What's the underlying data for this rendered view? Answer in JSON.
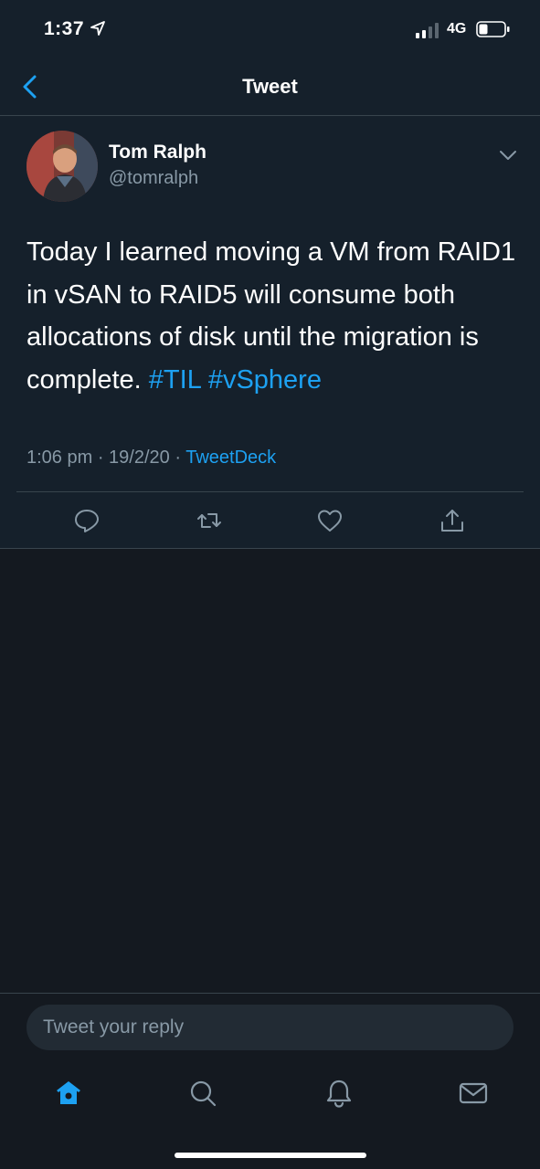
{
  "status_bar": {
    "time": "1:37",
    "network": "4G",
    "signal_bars_active": 2,
    "signal_bars_total": 4,
    "battery_level": 0.35
  },
  "nav": {
    "title": "Tweet",
    "back_icon": "chevron-left-icon"
  },
  "tweet": {
    "author_name": "Tom Ralph",
    "author_handle": "@tomralph",
    "text_plain": "Today I learned moving a VM from RAID1 in vSAN to RAID5 will consume both allocations of disk until the migration is complete.",
    "hashtag_1": "#TIL",
    "hashtag_2": "#vSphere",
    "time": "1:06 pm",
    "date": "19/2/20",
    "source": "TweetDeck",
    "actions": [
      "reply-icon",
      "retweet-icon",
      "like-icon",
      "share-icon"
    ]
  },
  "reply": {
    "placeholder": "Tweet your reply"
  },
  "tab_bar": {
    "items": [
      "home-icon",
      "search-icon",
      "notifications-icon",
      "messages-icon"
    ],
    "active": "home-icon"
  },
  "colors": {
    "background": "#15202b",
    "accent": "#1da1f2",
    "secondary_text": "#8899a6",
    "divider": "#38444d"
  }
}
